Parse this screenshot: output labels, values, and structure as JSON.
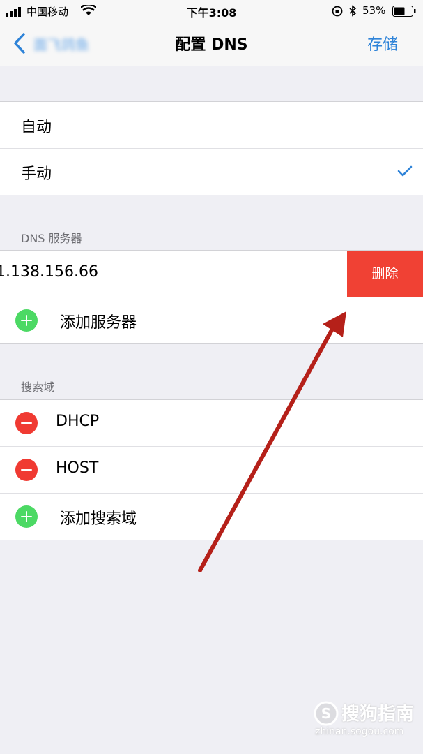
{
  "status_bar": {
    "carrier": "中国移动",
    "time": "下午3:08",
    "battery": "53%"
  },
  "nav": {
    "back_label": "面飞鸽鱼",
    "title": "配置 DNS",
    "save_label": "存储"
  },
  "mode": {
    "options": [
      "自动",
      "手动"
    ],
    "selected": "手动"
  },
  "dns": {
    "header": "DNS 服务器",
    "server": "1.138.156.66",
    "delete_label": "删除",
    "add_label": "添加服务器"
  },
  "search_domains": {
    "header": "搜索域",
    "items": [
      "DHCP",
      "HOST"
    ],
    "add_label": "添加搜索域"
  },
  "watermark": {
    "brand": "搜狗指南",
    "url": "zhinan.sogou.com"
  },
  "colors": {
    "accent": "#2e83d8",
    "delete": "#f04134",
    "add": "#4cd964",
    "remove": "#f03a32",
    "annotation_arrow": "#b52019"
  }
}
